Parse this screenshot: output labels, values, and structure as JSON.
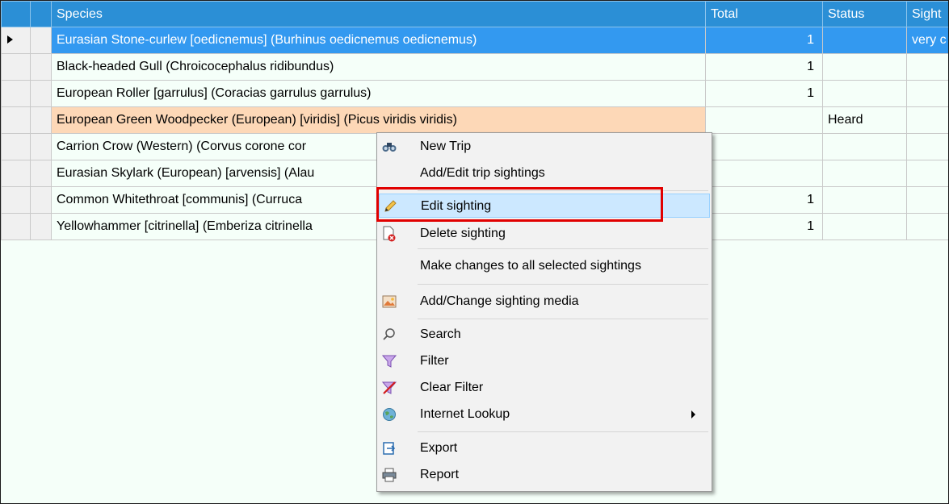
{
  "grid": {
    "columns": [
      "Species",
      "Total",
      "Status",
      "Sight"
    ],
    "rows": [
      {
        "species": "Eurasian Stone-curlew [oedicnemus] (Burhinus oedicnemus oedicnemus)",
        "total": "1",
        "status": "",
        "sight": "very c"
      },
      {
        "species": "Black-headed Gull (Chroicocephalus ridibundus)",
        "total": "1",
        "status": "",
        "sight": ""
      },
      {
        "species": "European Roller [garrulus] (Coracias garrulus garrulus)",
        "total": "1",
        "status": "",
        "sight": ""
      },
      {
        "species": "European Green Woodpecker (European) [viridis] (Picus viridis viridis)",
        "total": "",
        "status": "Heard",
        "sight": ""
      },
      {
        "species": "Carrion Crow (Western) (Corvus corone cor",
        "total": "",
        "status": "",
        "sight": ""
      },
      {
        "species": "Eurasian Skylark (European) [arvensis] (Alau",
        "total": "",
        "status": "",
        "sight": ""
      },
      {
        "species": "Common Whitethroat [communis] (Curruca",
        "total": "1",
        "status": "",
        "sight": ""
      },
      {
        "species": "Yellowhammer [citrinella] (Emberiza citrinella",
        "total": "1",
        "status": "",
        "sight": ""
      }
    ]
  },
  "context_menu": {
    "items": [
      {
        "label": "New Trip",
        "icon": "binoculars-icon"
      },
      {
        "label": "Add/Edit trip sightings",
        "icon": ""
      },
      {
        "label": "Edit sighting",
        "icon": "pencil-icon"
      },
      {
        "label": "Delete sighting",
        "icon": "delete-document-icon"
      },
      {
        "label": "Make changes to all selected sightings",
        "icon": ""
      },
      {
        "label": "Add/Change sighting media",
        "icon": "image-icon"
      },
      {
        "label": "Search",
        "icon": "magnifier-icon"
      },
      {
        "label": "Filter",
        "icon": "funnel-icon"
      },
      {
        "label": "Clear Filter",
        "icon": "clear-filter-icon"
      },
      {
        "label": "Internet Lookup",
        "icon": "globe-icon"
      },
      {
        "label": "Export",
        "icon": "export-icon"
      },
      {
        "label": "Report",
        "icon": "printer-icon"
      }
    ]
  },
  "colors": {
    "header": "#2b8fd6",
    "selected_row": "#3399f0",
    "highlighted_cell": "#fdd8b7",
    "menu_active": "#cce8ff",
    "callout": "#e10000"
  }
}
